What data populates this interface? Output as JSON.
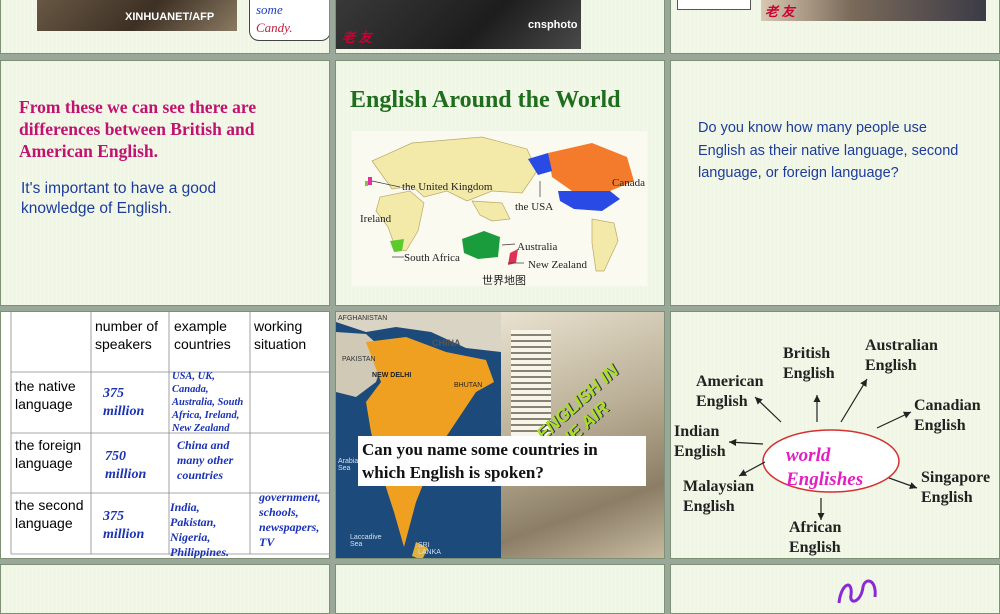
{
  "slide1": {
    "watermark": "XINHUANET/AFP"
  },
  "slide2": {
    "word_some": "some",
    "word_candy": "Candy."
  },
  "slide3": {
    "watermark": "cnsphoto"
  },
  "slide5": {
    "title": "From these we can see there are differences between British and American English.",
    "subtitle": "It's important to have a good knowledge of English."
  },
  "slide6": {
    "title": "English Around the World",
    "map_labels": {
      "uk": "the United Kingdom",
      "ireland": "Ireland",
      "usa": "the USA",
      "canada": "Canada",
      "australia": "Australia",
      "south_africa": "South Africa",
      "new_zealand": "New Zealand",
      "caption": "世界地图"
    }
  },
  "slide7": {
    "question": "Do you know how many people use English as their native language, second language, or foreign language?"
  },
  "slide8": {
    "headers": [
      "number of speakers",
      "example countries",
      "working situation"
    ],
    "rows": [
      {
        "label": "the native language",
        "count": "375 million",
        "examples": "USA, UK, Canada, Australia, South Africa, Ireland, New Zealand",
        "situation": ""
      },
      {
        "label": "the foreign language",
        "count": "750 million",
        "examples": "China and many other countries",
        "situation": ""
      },
      {
        "label": "the second language",
        "count": "375 million",
        "examples": "India, Pakistan, Nigeria, Philippines.",
        "situation": "government, schools, newspapers, TV"
      }
    ]
  },
  "slide9": {
    "question": "Can you name some countries in which English is spoken?",
    "map_labels": {
      "afghanistan": "AFGHANISTAN",
      "pakistan": "PAKISTAN",
      "china": "CHINA",
      "new_delhi": "NEW DELHI",
      "bhutan": "BHUTAN",
      "arabian_sea": "Arabian Sea",
      "sri_lanka": "SRI LANKA",
      "laccadive": "Laccadive Sea"
    },
    "poster_text": "ENGLISH IN THE AIR"
  },
  "slide10": {
    "center": "world Englishes",
    "varieties": {
      "british": "British English",
      "australian": "Australian English",
      "american": "American English",
      "canadian": "Canadian English",
      "indian": "Indian English",
      "singapore": "Singapore English",
      "malaysian": "Malaysian English",
      "african": "African English"
    }
  },
  "colors": {
    "title_magenta": "#c0126e",
    "title_green": "#1e6e1e",
    "body_blue": "#1d3c9c",
    "value_blue": "#1a32b4",
    "world_pink": "#e020c0",
    "ellipse_red": "#d63030"
  }
}
